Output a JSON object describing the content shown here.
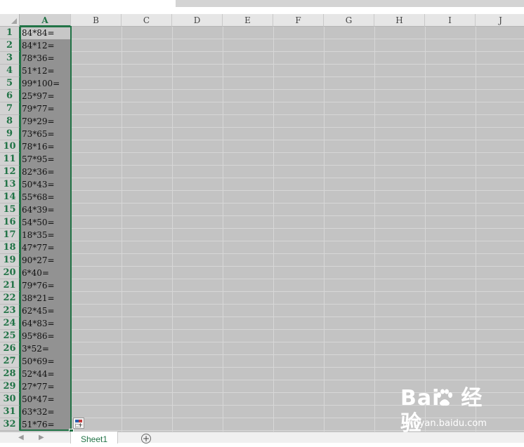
{
  "spreadsheet": {
    "columns": [
      "A",
      "B",
      "C",
      "D",
      "E",
      "F",
      "G",
      "H",
      "I",
      "J"
    ],
    "selected_column": "A",
    "rows": [
      {
        "n": "1",
        "a": "84*84="
      },
      {
        "n": "2",
        "a": "84*12="
      },
      {
        "n": "3",
        "a": "78*36="
      },
      {
        "n": "4",
        "a": "51*12="
      },
      {
        "n": "5",
        "a": "99*100="
      },
      {
        "n": "6",
        "a": "25*97="
      },
      {
        "n": "7",
        "a": "79*77="
      },
      {
        "n": "8",
        "a": "79*29="
      },
      {
        "n": "9",
        "a": "73*65="
      },
      {
        "n": "10",
        "a": "78*16="
      },
      {
        "n": "11",
        "a": "57*95="
      },
      {
        "n": "12",
        "a": "82*36="
      },
      {
        "n": "13",
        "a": "50*43="
      },
      {
        "n": "14",
        "a": "55*68="
      },
      {
        "n": "15",
        "a": "64*39="
      },
      {
        "n": "16",
        "a": "54*50="
      },
      {
        "n": "17",
        "a": "18*35="
      },
      {
        "n": "18",
        "a": "47*77="
      },
      {
        "n": "19",
        "a": "90*27="
      },
      {
        "n": "20",
        "a": "6*40="
      },
      {
        "n": "21",
        "a": "79*76="
      },
      {
        "n": "22",
        "a": "38*21="
      },
      {
        "n": "23",
        "a": "62*45="
      },
      {
        "n": "24",
        "a": "64*83="
      },
      {
        "n": "25",
        "a": "95*86="
      },
      {
        "n": "26",
        "a": "3*52="
      },
      {
        "n": "27",
        "a": "50*69="
      },
      {
        "n": "28",
        "a": "52*44="
      },
      {
        "n": "29",
        "a": "27*77="
      },
      {
        "n": "30",
        "a": "50*47="
      },
      {
        "n": "31",
        "a": "63*32="
      },
      {
        "n": "32",
        "a": "51*76="
      }
    ]
  },
  "sheet_tabs": {
    "active": "Sheet1",
    "add_symbol": "+",
    "nav_prev": "◀",
    "nav_next": "▶"
  },
  "quick_fill": {
    "badge": "+"
  },
  "watermark": {
    "logo_left": "Bai",
    "logo_right": "经验",
    "url": "jingyan.baidu.com"
  },
  "colors": {
    "accent_green": "#217346",
    "grid_bg": "#c3c3c3",
    "selected_cells": "#929292"
  }
}
